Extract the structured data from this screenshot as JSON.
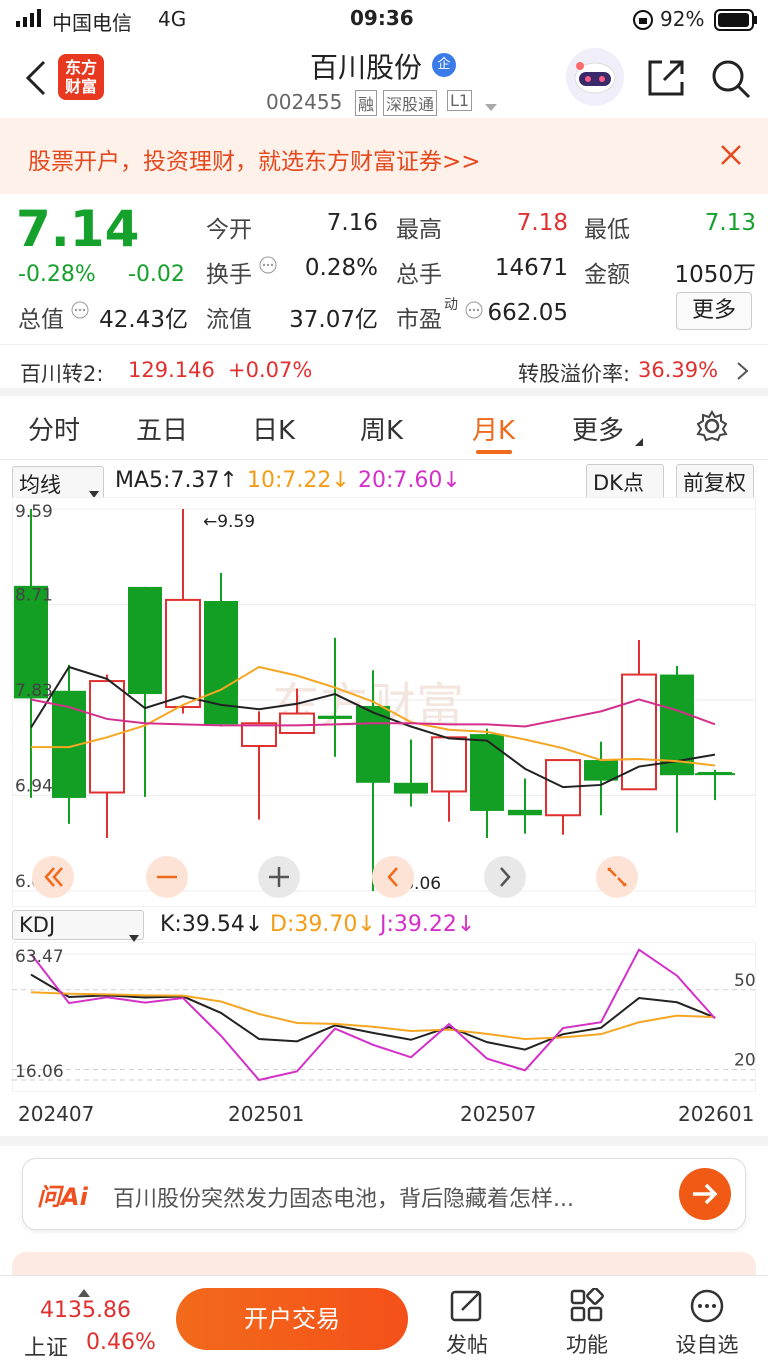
{
  "status": {
    "carrier": "中国电信",
    "network": "4G",
    "time": "09:36",
    "battery": "92%"
  },
  "header": {
    "logo_line1": "东方",
    "logo_line2": "财富",
    "title": "百川股份",
    "badge": "企",
    "code": "002455",
    "tag1": "融",
    "tag2": "深股通",
    "tag3": "L1"
  },
  "promo": {
    "text": "股票开户，投资理财，就选东方财富证券>>"
  },
  "quote": {
    "price": "7.14",
    "change_pct": "-0.28%",
    "change": "-0.02",
    "open_label": "今开",
    "open": "7.16",
    "high_label": "最高",
    "high": "7.18",
    "low_label": "最低",
    "low": "7.13",
    "turnover_label": "换手",
    "turnover": "0.28%",
    "volume_label": "总手",
    "volume": "14671",
    "amount_label": "金额",
    "amount": "1050万",
    "mktcap_label": "总值",
    "mktcap": "42.43亿",
    "float_label": "流值",
    "float": "37.07亿",
    "pe_label": "市盈",
    "pe_sup": "动",
    "pe": "662.05",
    "more_btn": "更多"
  },
  "convert": {
    "name": "百川转2:",
    "price": "129.146",
    "chg": "+0.07%",
    "premium_label": "转股溢价率:",
    "premium": "36.39%"
  },
  "tabs": [
    "分时",
    "五日",
    "日K",
    "周K",
    "月K",
    "更多"
  ],
  "active_tab": 4,
  "indicators": {
    "ma_select": "均线",
    "ma5": "MA5:7.37↑",
    "ma10": "10:7.22↓",
    "ma20": "20:7.60↓",
    "dk_btn": "DK点",
    "restore_btn": "前复权"
  },
  "kdj_row": {
    "select": "KDJ",
    "k": "K:39.54↓",
    "d": "D:39.70↓",
    "j": "J:39.22↓"
  },
  "ai": {
    "logo": "问Ai",
    "text": "百川股份突然发力固态电池，背后隐藏着怎样..."
  },
  "bottom": {
    "index_value": "4135.86",
    "index_name": "上证",
    "index_pct": "0.46%",
    "trade_btn": "开户交易",
    "nav": [
      "发帖",
      "功能",
      "设自选"
    ]
  },
  "chart_data": [
    {
      "type": "candlestick",
      "title": "月K",
      "y_labels": [
        "9.59",
        "8.71",
        "7.83",
        "6.94",
        "6.06"
      ],
      "ylim": [
        6.06,
        9.59
      ],
      "max_label": "←9.59",
      "min_label": "←6.06",
      "watermark": "东方财富",
      "candles": [
        {
          "o": 8.88,
          "c": 7.84,
          "h": 9.59,
          "l": 6.92
        },
        {
          "o": 7.91,
          "c": 6.92,
          "h": 8.15,
          "l": 6.68
        },
        {
          "o": 6.97,
          "c": 8.0,
          "h": 8.06,
          "l": 6.55
        },
        {
          "o": 8.87,
          "c": 7.88,
          "h": 8.87,
          "l": 6.93
        },
        {
          "o": 7.76,
          "c": 8.75,
          "h": 9.59,
          "l": 7.7
        },
        {
          "o": 8.74,
          "c": 7.6,
          "h": 9.0,
          "l": 7.58
        },
        {
          "o": 7.4,
          "c": 7.61,
          "h": 7.72,
          "l": 6.72
        },
        {
          "o": 7.52,
          "c": 7.7,
          "h": 7.93,
          "l": 7.54
        },
        {
          "o": 7.68,
          "c": 7.65,
          "h": 8.4,
          "l": 7.3
        },
        {
          "o": 7.77,
          "c": 7.06,
          "h": 8.1,
          "l": 6.06
        },
        {
          "o": 7.06,
          "c": 6.96,
          "h": 7.46,
          "l": 6.84
        },
        {
          "o": 6.98,
          "c": 7.48,
          "h": 7.48,
          "l": 6.7
        },
        {
          "o": 7.51,
          "c": 6.8,
          "h": 7.56,
          "l": 6.55
        },
        {
          "o": 6.81,
          "c": 6.76,
          "h": 7.1,
          "l": 6.59
        },
        {
          "o": 6.76,
          "c": 7.27,
          "h": 7.27,
          "l": 6.58
        },
        {
          "o": 7.27,
          "c": 7.08,
          "h": 7.44,
          "l": 6.76
        },
        {
          "o": 7.0,
          "c": 8.06,
          "h": 8.38,
          "l": 7.0
        },
        {
          "o": 8.06,
          "c": 7.13,
          "h": 8.14,
          "l": 6.6
        },
        {
          "o": 7.16,
          "c": 7.14,
          "h": 7.18,
          "l": 6.9
        }
      ],
      "series": [
        {
          "name": "MA5",
          "color": "#222222",
          "values": [
            7.57,
            8.13,
            8.02,
            7.75,
            7.86,
            7.78,
            7.74,
            7.79,
            7.88,
            7.71,
            7.58,
            7.47,
            7.45,
            7.19,
            7.02,
            7.04,
            7.21,
            7.26,
            7.32
          ]
        },
        {
          "name": "MA10",
          "color": "#f5a623",
          "values": [
            7.39,
            7.39,
            7.48,
            7.59,
            7.78,
            7.92,
            8.13,
            8.05,
            7.94,
            7.81,
            7.62,
            7.55,
            7.53,
            7.46,
            7.38,
            7.27,
            7.28,
            7.26,
            7.22
          ]
        },
        {
          "name": "MA20",
          "color": "#d42f8c",
          "values": [
            7.83,
            7.76,
            7.65,
            7.61,
            7.6,
            7.59,
            7.59,
            7.59,
            7.6,
            7.61,
            7.61,
            7.6,
            7.6,
            7.58,
            7.65,
            7.72,
            7.83,
            7.73,
            7.6
          ]
        }
      ]
    },
    {
      "type": "line",
      "title": "KDJ",
      "y_labels": [
        "63.47",
        "50",
        "20",
        "16.06"
      ],
      "ylim": [
        16.06,
        63.47
      ],
      "x_labels": [
        "202407",
        "202501",
        "202507",
        "202601"
      ],
      "series": [
        {
          "name": "K",
          "color": "#222222",
          "values": [
            55.7,
            47.3,
            47.9,
            47.1,
            47.5,
            41.3,
            31.5,
            30.6,
            36.6,
            33.8,
            31.2,
            36.0,
            30.3,
            27.5,
            33.3,
            35.7,
            46.9,
            45.3,
            39.54
          ]
        },
        {
          "name": "D",
          "color": "#f5a623",
          "values": [
            49.1,
            48.5,
            48.3,
            47.9,
            47.8,
            45.6,
            40.9,
            37.5,
            37.2,
            36.1,
            34.5,
            35.0,
            33.4,
            31.5,
            32.1,
            33.3,
            37.8,
            40.3,
            39.7
          ]
        },
        {
          "name": "J",
          "color": "#d42fc8",
          "values": [
            63.47,
            45.0,
            47.2,
            45.2,
            46.9,
            32.7,
            16.06,
            19.3,
            35.4,
            29.3,
            24.6,
            37.1,
            24.1,
            19.7,
            35.6,
            37.8,
            65.1,
            55.3,
            39.22
          ]
        }
      ]
    }
  ]
}
